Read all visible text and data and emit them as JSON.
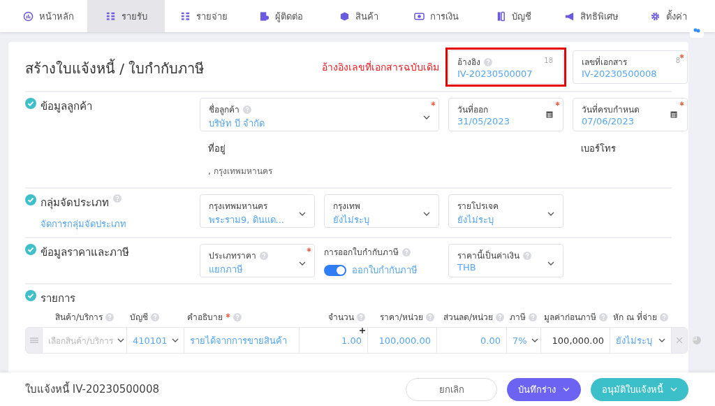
{
  "nav": [
    {
      "label": "หน้าหลัก",
      "kind": "dashboard",
      "selected": false
    },
    {
      "label": "รายรับ",
      "kind": "income",
      "selected": true
    },
    {
      "label": "รายจ่าย",
      "kind": "expense",
      "selected": false
    },
    {
      "label": "ผู้ติดต่อ",
      "kind": "contacts",
      "selected": false
    },
    {
      "label": "สินค้า",
      "kind": "box",
      "selected": false
    },
    {
      "label": "การเงิน",
      "kind": "money",
      "selected": false
    },
    {
      "label": "บัญชี",
      "kind": "book",
      "selected": false
    },
    {
      "label": "สิทธิพิเศษ",
      "kind": "megaphone",
      "selected": false
    },
    {
      "label": "ตั้งค่า",
      "kind": "gear",
      "selected": false
    }
  ],
  "title": "สร้างใบแจ้งหนี้ / ใบกำกับภาษี",
  "annotation": "อ้างอิงเลขที่เอกสารฉบับเดิม",
  "header_fields": [
    {
      "kind": "text",
      "label": "อ้างอิง",
      "help": true,
      "counter": "18",
      "value": "IV-20230500007",
      "highlighted": true
    },
    {
      "kind": "text",
      "label": "เลขที่เอกสาร",
      "required": true,
      "counter": "8",
      "value": "IV-20230500008"
    }
  ],
  "sections": [
    {
      "title": "ข้อมูลลูกค้า",
      "fields": [
        {
          "kind": "select",
          "label": "ชื่อลูกค้า",
          "help": true,
          "required": true,
          "value": "บริษัท บี จำกัด"
        },
        {
          "kind": "date",
          "label": "วันที่ออก",
          "required": true,
          "value": "31/05/2023"
        },
        {
          "kind": "date",
          "label": "วันที่ครบกำหนด",
          "required": true,
          "value": "07/06/2023"
        }
      ],
      "info": [
        {
          "label": "ที่อยู่",
          "value": ", กรุงเทพมหานคร"
        },
        {
          "label": "เบอร์โทร"
        }
      ]
    },
    {
      "title": "กลุ่มจัดประเภท",
      "help": true,
      "link": "จัดการกลุ่มจัดประเภท",
      "fields": [
        {
          "kind": "select",
          "label": "กรุงเทพมหานคร",
          "value": "พระราม9, ดินแด..."
        },
        {
          "kind": "select",
          "label": "กรุงเทพ",
          "value": "ยังไม่ระบุ"
        },
        {
          "kind": "select",
          "label": "รายโปรเจค",
          "value": "ยังไม่ระบุ"
        }
      ]
    },
    {
      "title": "ข้อมูลราคาและภาษี",
      "fields": [
        {
          "kind": "select",
          "label": "ประเภทราคา",
          "help": true,
          "required": true,
          "value": "แยกภาษี"
        },
        {
          "kind": "toggle",
          "label": "การออกใบกำกับภาษี",
          "help": true,
          "on": true,
          "value": "ออกใบกำกับภาษี"
        },
        {
          "kind": "select",
          "label": "ราคานี้เป็นค่าเงิน",
          "help": true,
          "value": "THB"
        }
      ]
    }
  ],
  "items": {
    "title": "รายการ",
    "columns": [
      {
        "label": "สินค้า/บริการ",
        "help": true
      },
      {
        "label": "บัญชี",
        "help": true
      },
      {
        "label": "คำอธิบาย",
        "help": true,
        "required": true
      },
      {
        "label": "จำนวน",
        "help": true
      },
      {
        "label": "ราคา/หน่วย",
        "help": true
      },
      {
        "label": "ส่วนลด/หน่วย",
        "help": true
      },
      {
        "label": "ภาษี",
        "help": true
      },
      {
        "label": "มูลค่าก่อนภาษี",
        "help": true
      },
      {
        "label": "หัก ณ ที่จ่าย",
        "help": true
      }
    ],
    "rows": [
      {
        "product_placeholder": "เลือกสินค้า/บริการ",
        "account": "410101",
        "description": "รายได้จากการขายสินค้า",
        "quantity": "1.00",
        "price": "100,000.00",
        "discount": "0.00",
        "tax": "7%",
        "amount": "100,000.00",
        "withholding": "ยังไม่ระบุ"
      }
    ]
  },
  "footer": {
    "document": "ใบแจ้งหนี้ IV-20230500008",
    "buttons": [
      {
        "kind": "cancel",
        "label": "ยกเลิก"
      },
      {
        "kind": "draft",
        "label": "บันทึกร่าง"
      },
      {
        "kind": "approve",
        "label": "อนุมัติใบแจ้งหนี้"
      }
    ]
  }
}
